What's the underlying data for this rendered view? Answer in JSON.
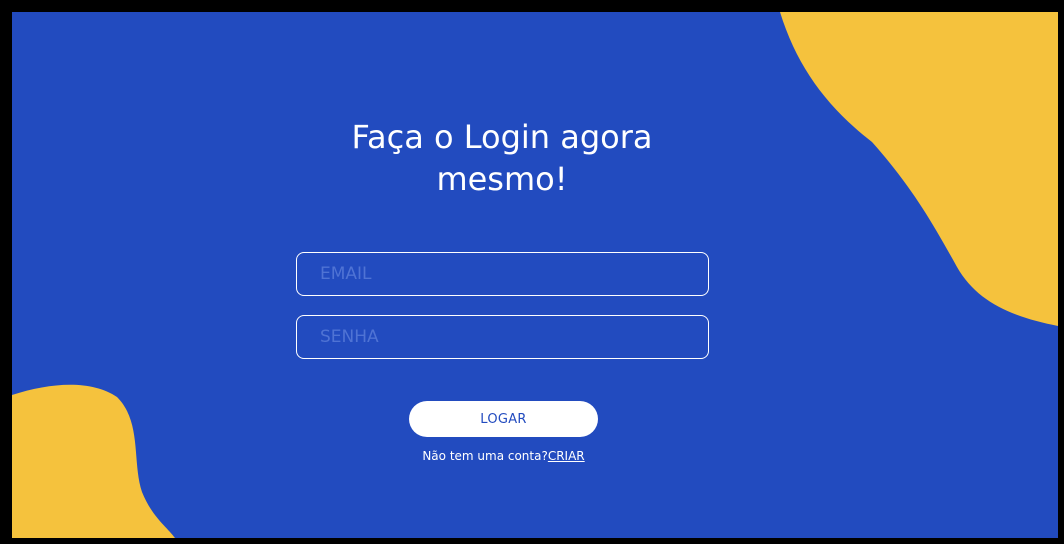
{
  "colors": {
    "background": "#224bbf",
    "accent_blob": "#f5c23d",
    "text": "#ffffff",
    "placeholder": "#4f73d4",
    "button_text": "#224bbf",
    "outer_border": "#000000"
  },
  "login": {
    "title_line1": "Faça o Login agora",
    "title_line2": "mesmo!",
    "email_placeholder": "EMAIL",
    "password_placeholder": "SENHA",
    "button_label": "LOGAR",
    "no_account_text": "Não tem uma conta?",
    "create_link_label": "CRIAR"
  }
}
